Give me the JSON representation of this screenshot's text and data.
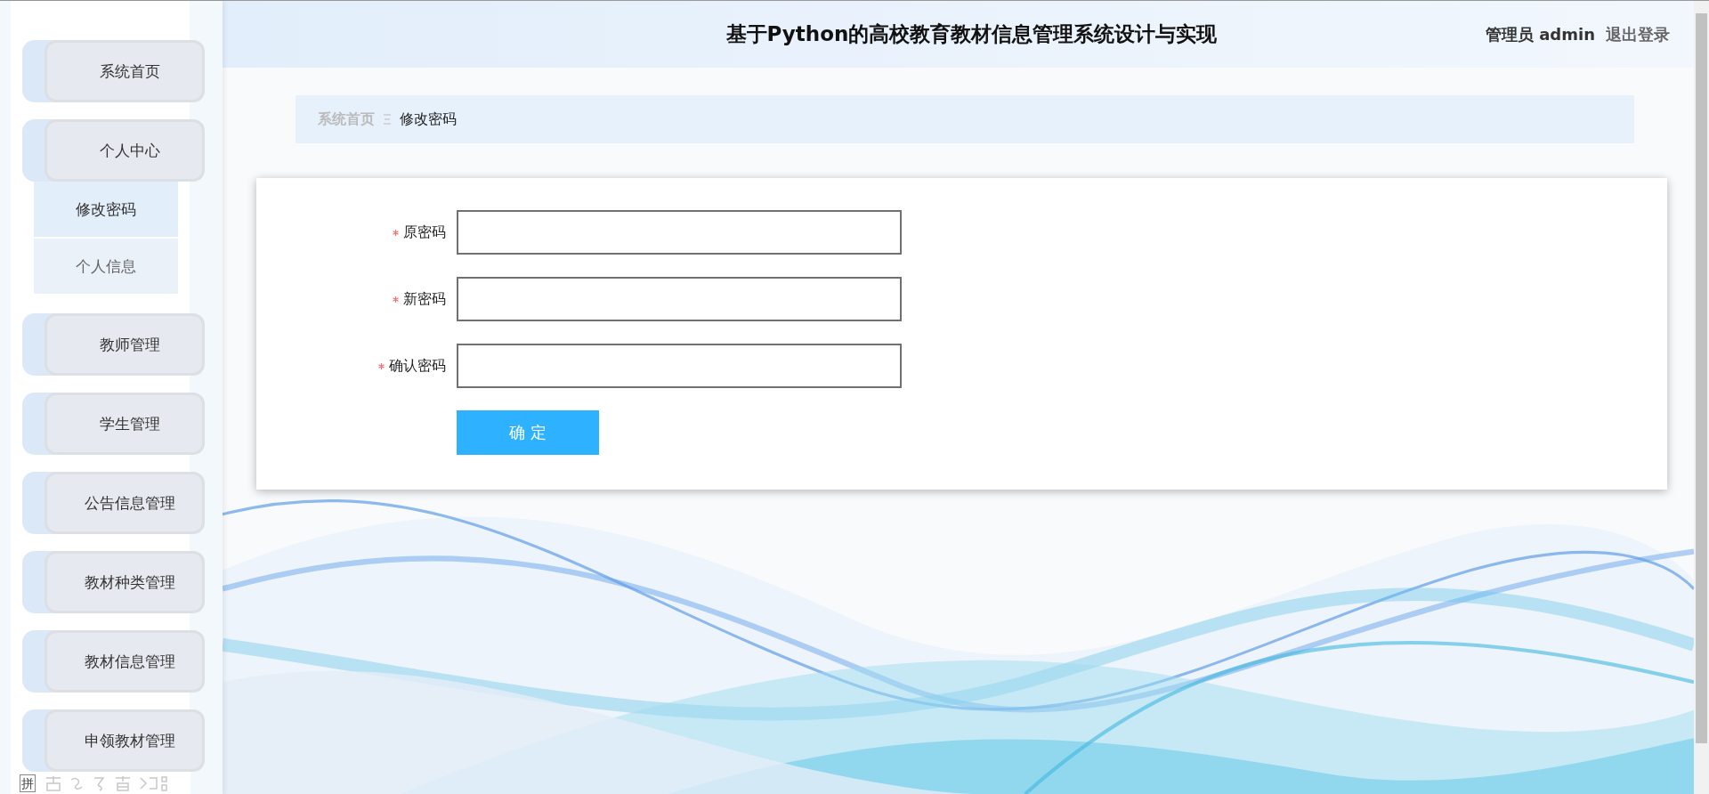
{
  "header": {
    "title": "基于Python的高校教育教材信息管理系统设计与实现",
    "user": "管理员 admin",
    "logout": "退出登录"
  },
  "sidebar": {
    "items": [
      {
        "label": "系统首页"
      },
      {
        "label": "个人中心",
        "children": [
          {
            "label": "修改密码",
            "selected": true
          },
          {
            "label": "个人信息",
            "selected": false
          }
        ]
      },
      {
        "label": "教师管理"
      },
      {
        "label": "学生管理"
      },
      {
        "label": "公告信息管理"
      },
      {
        "label": "教材种类管理"
      },
      {
        "label": "教材信息管理"
      },
      {
        "label": "申领教材管理"
      }
    ]
  },
  "breadcrumb": [
    {
      "label": "系统首页"
    },
    {
      "label": "修改密码"
    }
  ],
  "form": {
    "fields": [
      {
        "label": "原密码",
        "required": true
      },
      {
        "label": "新密码",
        "required": true
      },
      {
        "label": "确认密码",
        "required": true
      }
    ],
    "submit": "确 定"
  },
  "ime_toolbar": {
    "mode": "拼"
  }
}
